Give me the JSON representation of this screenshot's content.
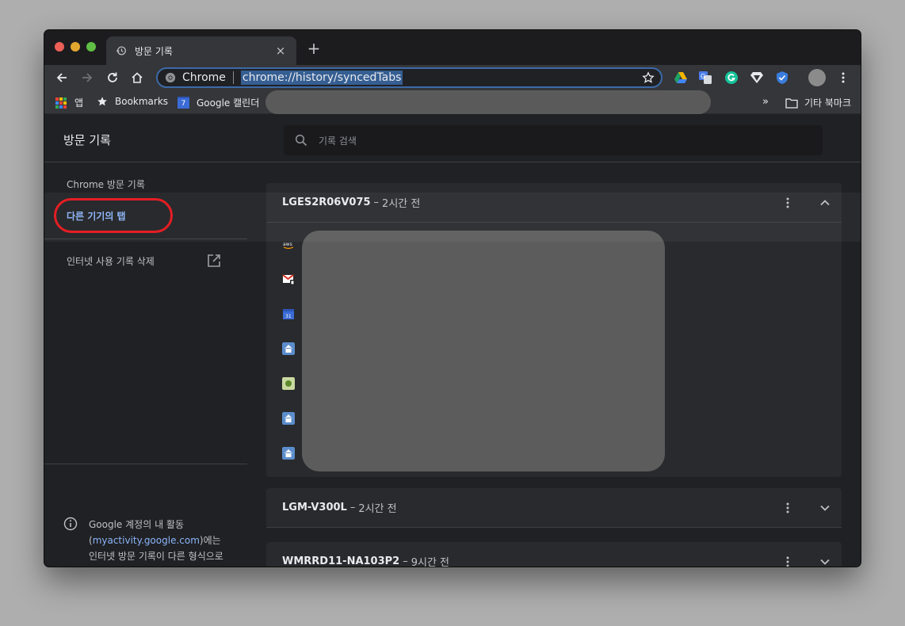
{
  "browser": {
    "tab_title": "방문 기록",
    "new_tab_symbol": "+",
    "close_symbol": "×",
    "omnibox_label": "Chrome",
    "omnibox_url": "chrome://history/syncedTabs"
  },
  "bookmarks": {
    "apps_label": "앱",
    "bookmarks_label": "Bookmarks",
    "calendar_label": "Google 캘린더",
    "calendar_date": "7",
    "overflow_label": "»",
    "other_label": "기타 북마크"
  },
  "history": {
    "title": "방문 기록",
    "search_placeholder": "기록 검색"
  },
  "sidebar": {
    "items": [
      {
        "label": "Chrome 방문 기록"
      },
      {
        "label": "다른 기기의 탭"
      },
      {
        "label": "인터넷 사용 기록 삭제"
      }
    ],
    "info_prefix": "Google 계정의 내 활동 (",
    "info_link": "myactivity.google.com",
    "info_suffix": ")에는 인터넷 방문 기록이 다른 형식으로 남아 있을 수도 있습니다"
  },
  "devices": [
    {
      "name": "LGES2R06V075",
      "separator": "–",
      "time": "2시간 전",
      "expanded": true
    },
    {
      "name": "LGM-V300L",
      "separator": "–",
      "time": "2시간 전",
      "expanded": false
    },
    {
      "name": "WMRRD11-NA103P2",
      "separator": "–",
      "time": "9시간 전",
      "expanded": false
    }
  ],
  "favicons": [
    "aws-icon",
    "gmail-icon",
    "calendar-icon",
    "home-icon",
    "puzzle-icon",
    "home-icon",
    "home-icon"
  ],
  "colors": {
    "accent_link": "#8ab4f8",
    "highlight_ring": "#e3141b",
    "url_selection": "#355e93"
  }
}
